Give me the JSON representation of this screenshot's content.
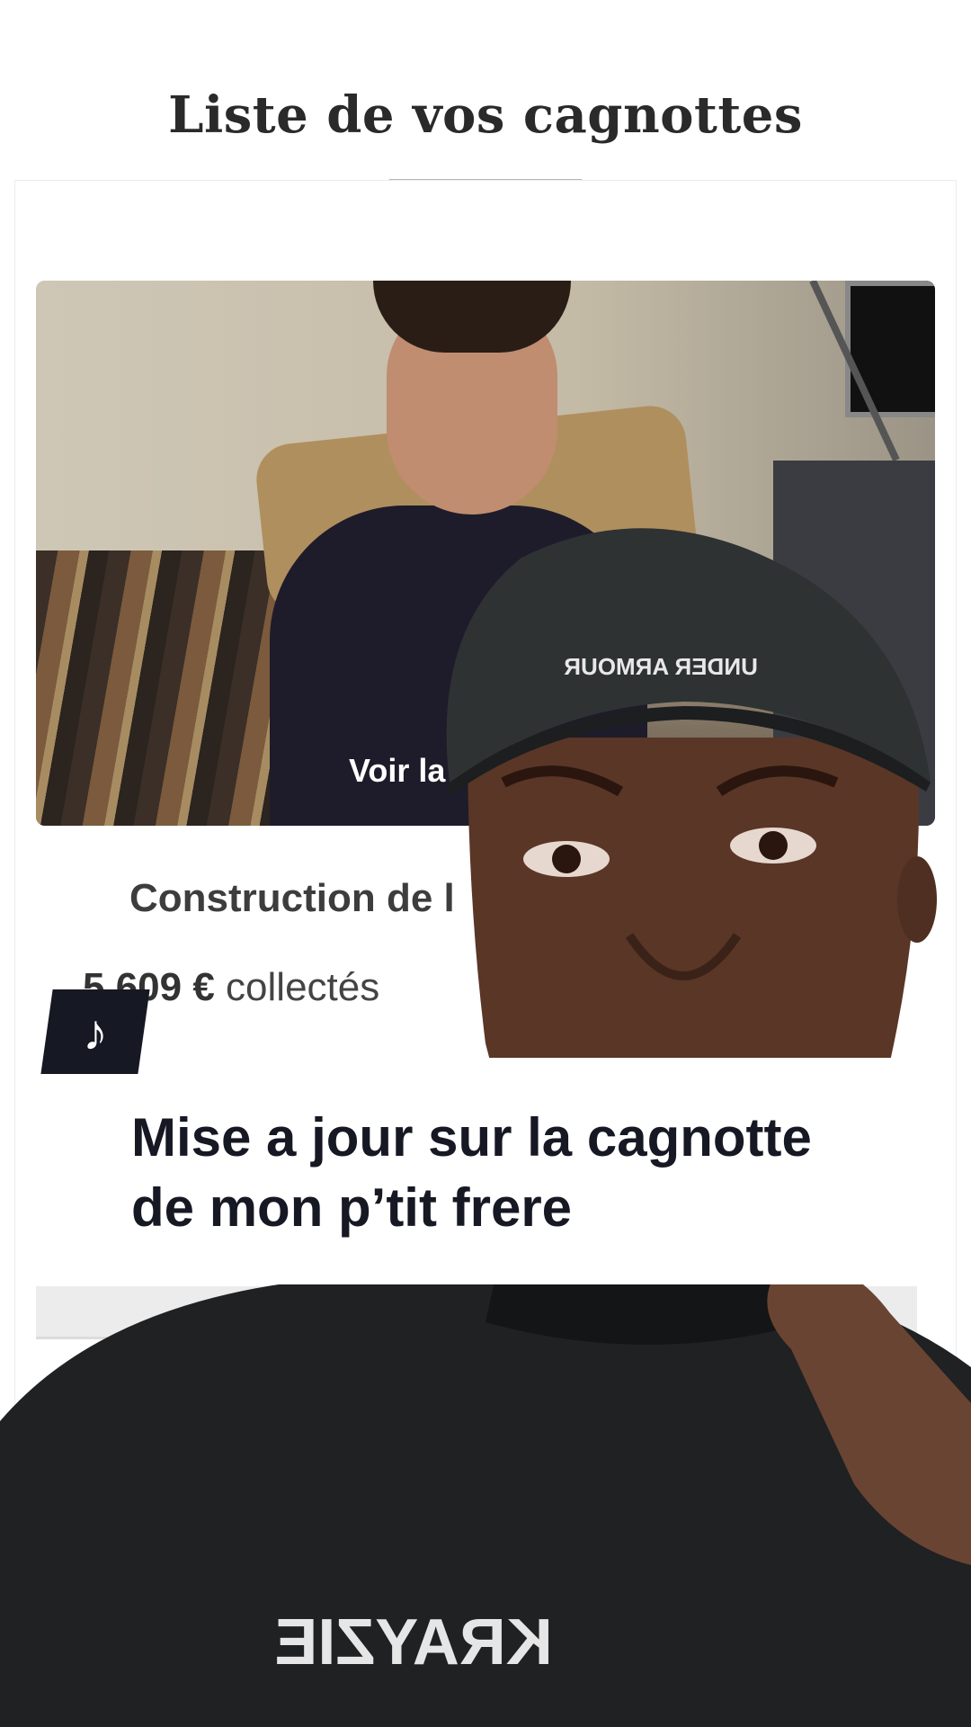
{
  "header": {
    "title": "Liste de vos cagnottes"
  },
  "card": {
    "photo_caption": "Voir la",
    "fundraiser_title": "Construction de l",
    "amount_value": "5 609 €",
    "amount_suffix": "collectés"
  },
  "overlay": {
    "caption_line1": "Mise a jour sur la cagnotte",
    "caption_line2": "de mon p’tit frere",
    "logo_icon": "tiktok-icon",
    "cap_text": "UNDER ARMOUR",
    "shirt_text": "KRAYZIE"
  }
}
